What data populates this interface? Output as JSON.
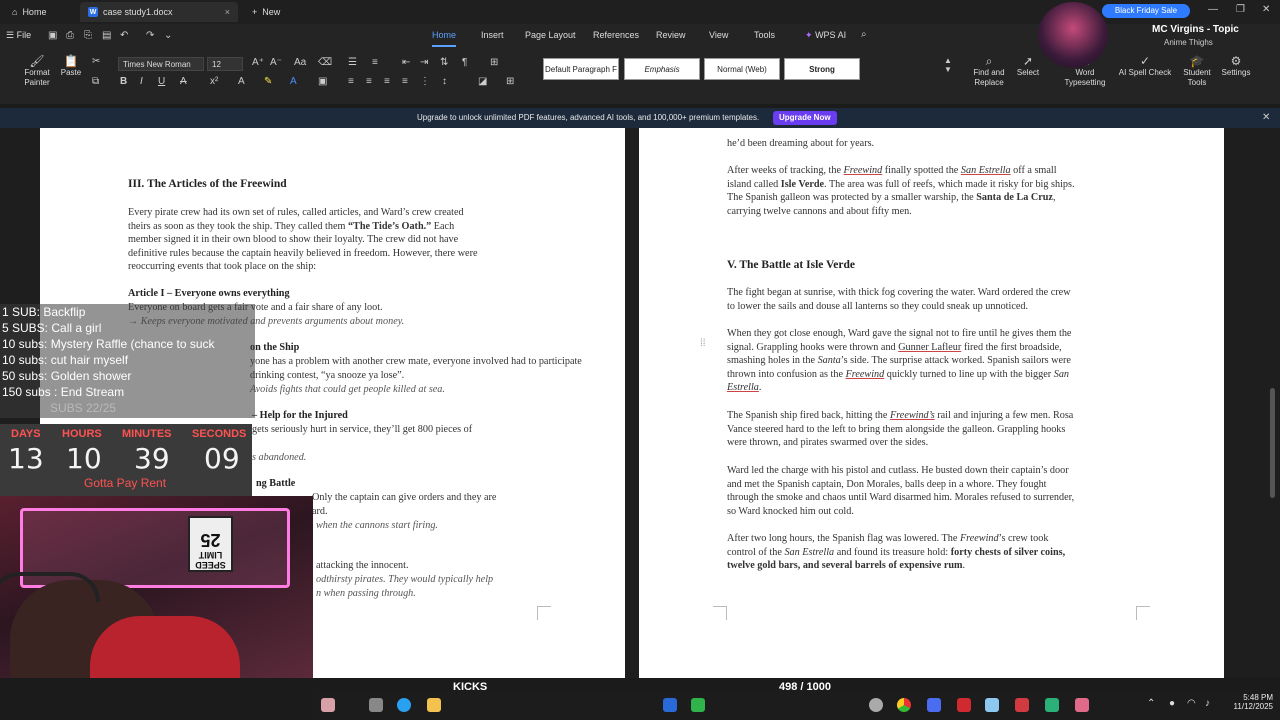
{
  "titlebar": {
    "tabs": [
      {
        "label": "Home"
      },
      {
        "label": "case study1.docx"
      }
    ],
    "new_label": "New"
  },
  "menubar": {
    "file_label": "File",
    "items": [
      {
        "label": "Home"
      },
      {
        "label": "Insert"
      },
      {
        "label": "Page Layout"
      },
      {
        "label": "References"
      },
      {
        "label": "Review"
      },
      {
        "label": "View"
      },
      {
        "label": "Tools"
      },
      {
        "label": "WPS AI"
      }
    ]
  },
  "ribbon": {
    "format_painter": "Format Painter",
    "paste": "Paste",
    "font_name": "Times New Roman",
    "font_size": "12",
    "styles": [
      "Default Paragraph F",
      "Emphasis",
      "Normal (Web)",
      "Strong"
    ],
    "find_replace": "Find and Replace",
    "select": "Select",
    "word_typesetting": "Word Typesetting",
    "ai_spell_check": "AI Spell Check",
    "student_tools": "Student Tools",
    "settings": "Settings"
  },
  "promo": {
    "badge": "Black Friday Sale",
    "channel": "MC Virgins - Topic",
    "song": "Anime Thighs"
  },
  "banner": {
    "text": "Upgrade to unlock unlimited PDF features, advanced AI tools, and 100,000+ premium templates.",
    "button": "Upgrade Now"
  },
  "left_page": {
    "heading": "III. The Articles of the Freewind",
    "intro": [
      {
        "pre": "Every pirate crew had its own set of rules, called articles, and Ward’s crew created"
      },
      {
        "pre": "theirs as soon as they took the ship. They called them ",
        "bold": "“The Tide’s Oath.”",
        "post": " Each"
      },
      {
        "pre": "member signed it in their own blood to show their loyalty. The crew did not have"
      },
      {
        "pre": "definitive rules because the captain heavily believed in freedom. However, there were"
      },
      {
        "pre": "reoccurring events that took place on the ship:"
      }
    ],
    "article1_title": "Article I – Everyone owns everything",
    "article1_text": "Everyone on board gets a fair vote and a fair share of any loot.",
    "article1_note": "→ Keeps everyone motivated and prevents arguments about money.",
    "article2_title": "on the Ship",
    "article2_line1": "yone has a problem with another crew mate, everyone involved had to participate",
    "article2_line2": "drinking contest, “ya snooze ya lose”.",
    "article2_note": "Avoids fights that could get people killed at sea.",
    "article3_title": "– Help for the Injured",
    "article3_line": "gets seriously hurt in service, they’ll get 800 pieces of",
    "article3_note": "s abandoned.",
    "article4_title": "ng Battle",
    "article4_line1": "Only the captain can give orders and they are",
    "article4_line2": "ard.",
    "article4_note": "when the cannons start firing.",
    "article5_line": "attacking the innocent.",
    "article5_note1": "odthirsty pirates. They would typically help",
    "article5_note2": "n when passing through."
  },
  "right_page": {
    "top_line": "he’d been dreaming about for years.",
    "p1": [
      [
        {
          "t": "After weeks of tracking, the "
        },
        {
          "t": "Freewind",
          "i": true,
          "u": true
        },
        {
          "t": " finally spotted the "
        },
        {
          "t": "San Estrella",
          "i": true,
          "u": true
        },
        {
          "t": " off a small"
        }
      ],
      [
        {
          "t": "island called "
        },
        {
          "t": "Isle Verde",
          "b": true
        },
        {
          "t": ". The area was full of reefs, which made it risky for big ships."
        }
      ],
      [
        {
          "t": "The Spanish galleon was protected by a smaller warship, the "
        },
        {
          "t": "Santa de La Cruz",
          "b": true
        },
        {
          "t": ","
        }
      ],
      [
        {
          "t": "carrying twelve cannons and about fifty men."
        }
      ]
    ],
    "heading": "V. The Battle at Isle Verde",
    "p2": [
      [
        {
          "t": "The fight began at sunrise, with thick fog covering the water. Ward ordered the crew"
        }
      ],
      [
        {
          "t": "to lower the sails and douse all lanterns so they could sneak up unnoticed."
        }
      ]
    ],
    "p3": [
      [
        {
          "t": "When they got close enough, Ward gave the signal not to fire until he gives them the"
        }
      ],
      [
        {
          "t": "signal. Grappling hooks were thrown and "
        },
        {
          "t": "Gunner Lafleur",
          "u": true
        },
        {
          "t": " fired the first broadside,"
        }
      ],
      [
        {
          "t": "smashing holes in the "
        },
        {
          "t": "Santa",
          "i": true
        },
        {
          "t": "’s side. The surprise attack worked. Spanish sailors were"
        }
      ],
      [
        {
          "t": "thrown into confusion as the "
        },
        {
          "t": "Freewind",
          "i": true,
          "u": true
        },
        {
          "t": " quickly turned to line up with the bigger "
        },
        {
          "t": "San",
          "i": true
        }
      ],
      [
        {
          "t": "Estrella",
          "i": true,
          "u": true
        },
        {
          "t": "."
        }
      ]
    ],
    "p4": [
      [
        {
          "t": "The Spanish ship fired back, hitting the "
        },
        {
          "t": "Freewind’s",
          "i": true,
          "u": true
        },
        {
          "t": " rail and injuring a few men. Rosa"
        }
      ],
      [
        {
          "t": "Vance steered hard to the left to bring them alongside the galleon. Grappling hooks"
        }
      ],
      [
        {
          "t": "were thrown, and pirates swarmed over the sides."
        }
      ]
    ],
    "p5": [
      [
        {
          "t": "Ward led the charge with his pistol and cutlass. He busted down their captain’s door"
        }
      ],
      [
        {
          "t": "and met the Spanish captain, Don Morales, balls deep in a whore. They fought"
        }
      ],
      [
        {
          "t": "through the smoke and chaos until Ward disarmed him. Morales refused to surrender,"
        }
      ],
      [
        {
          "t": "so Ward knocked him out cold."
        }
      ]
    ],
    "p6": [
      [
        {
          "t": "After two long hours, the Spanish flag was lowered. The "
        },
        {
          "t": "Freewind",
          "i": true
        },
        {
          "t": "’s crew took"
        }
      ],
      [
        {
          "t": "control of the "
        },
        {
          "t": "San Estrella",
          "i": true
        },
        {
          "t": " and found its treasure hold: "
        },
        {
          "t": "forty chests of silver coins,",
          "b": true
        }
      ],
      [
        {
          "t": "twelve gold bars, and several barrels of expensive rum",
          "b": true
        },
        {
          "t": "."
        }
      ]
    ]
  },
  "stream_overlay": {
    "goals": [
      "1 SUB: Backflip",
      "5 SUBS: Call a girl",
      "10 subs: Mystery Raffle (chance to suck",
      "10 subs: cut hair myself",
      "50 subs: Golden shower",
      "150 subs : End Stream"
    ],
    "faded": "SUBS 22/25",
    "countdown": [
      {
        "label": "DAYS",
        "value": "13"
      },
      {
        "label": "HOURS",
        "value": "10"
      },
      {
        "label": "MINUTES",
        "value": "39"
      },
      {
        "label": "SECONDS",
        "value": "09"
      }
    ],
    "caption": "Gotta Pay Rent",
    "sign_line1": "SPEED",
    "sign_line2": "LIMIT",
    "sign_line3": "25",
    "kicks_label": "KICKS",
    "kicks_count": "498 / 1000",
    "kicks_progress": 0.498
  },
  "taskbar": {
    "time": "5:48 PM",
    "date": "11/12/2025"
  }
}
